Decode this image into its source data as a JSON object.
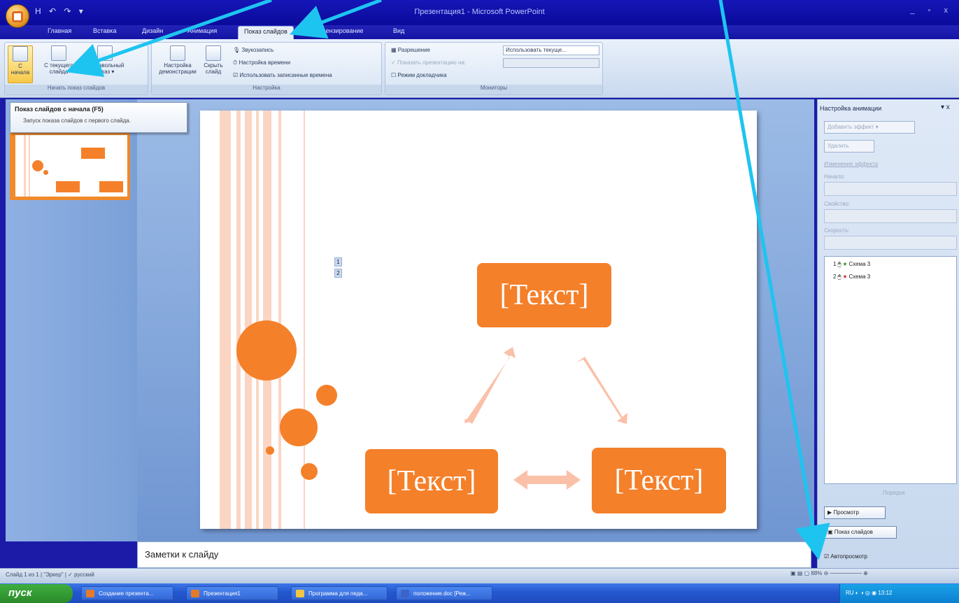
{
  "window": {
    "title": "Презентация1 - Microsoft PowerPoint",
    "qat": "H ↶ ↷ ▾",
    "controls": "_ ▫ x"
  },
  "tabs": [
    "Главная",
    "Вставка",
    "Дизайн",
    "Анимация",
    "Показ слайдов",
    "Рецензирование",
    "Вид"
  ],
  "ribbon": {
    "start_group": {
      "title": "Начать показ слайдов",
      "btn_from_start": "С начала",
      "btn_from_current": "С текущего слайда",
      "btn_custom": "Произвольный показ ▾"
    },
    "setup_group": {
      "title": "Настройка",
      "btn_setup": "Настройка демонстрации",
      "btn_hide": "Скрыть слайд",
      "row_record": "Звукозапись",
      "row_timing": "Настройка времени",
      "row_use_timing": "Использовать записанные времена"
    },
    "monitors_group": {
      "title": "Мониторы",
      "row_resolution": "Разрешение",
      "resolution_value": "Использовать текуще...",
      "row_show_on": "Показать презентацию на:",
      "row_presenter": "Режим докладчика"
    }
  },
  "tooltip": {
    "title": "Показ слайдов с начала (F5)",
    "text": "Запуск показа слайдов с первого слайда."
  },
  "slide": {
    "text_top": "[Текст]",
    "text_left": "[Текст]",
    "text_right": "[Текст]",
    "anim_tag_1": "1",
    "anim_tag_2": "2"
  },
  "notes": {
    "placeholder": "Заметки к слайду"
  },
  "task_pane": {
    "title": "Настройка анимации",
    "close": "▾ x",
    "btn_add_effect": "Добавить эффект ▾",
    "btn_remove": "Удалить",
    "section_change": "Изменение эффекта",
    "lbl_start": "Начало:",
    "lbl_property": "Свойство:",
    "lbl_speed": "Скорость:",
    "items": [
      {
        "num": "1",
        "label": "Схема 3"
      },
      {
        "num": "2",
        "label": "Схема 3"
      }
    ],
    "order_label": "Порядок",
    "btn_preview": "Просмотр",
    "btn_slideshow": "Показ слайдов",
    "autopreview": "Автопросмотр"
  },
  "status": {
    "slide_info": "Слайд 1 из 1",
    "theme": "\"Эркер\"",
    "language": "русский",
    "zoom": "88%"
  },
  "taskbar": {
    "start": "пуск",
    "items": [
      "Создание презента...",
      "Презентация1",
      "Программа для педа...",
      "положение.doc [Реж..."
    ],
    "lang": "RU",
    "time": "13:12"
  },
  "colors": {
    "accent": "#f4802a",
    "arrow": "#1ec4f0",
    "background": "#1b1ba8"
  }
}
